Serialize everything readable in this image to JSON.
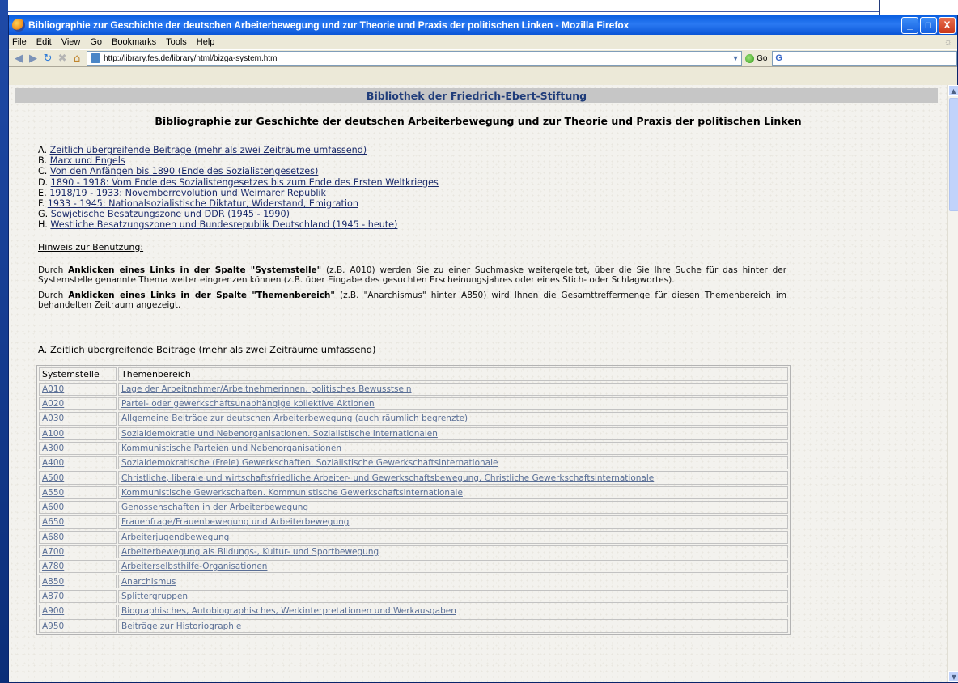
{
  "window": {
    "title": "Bibliographie zur Geschichte der deutschen Arbeiterbewegung und zur Theorie und Praxis der politischen Linken - Mozilla Firefox",
    "minimize": "_",
    "maximize": "□",
    "close": "X"
  },
  "menu": [
    "File",
    "Edit",
    "View",
    "Go",
    "Bookmarks",
    "Tools",
    "Help"
  ],
  "navigation": {
    "url": "http://library.fes.de/library/html/bizga-system.html",
    "go_label": "Go",
    "search_icon": "G"
  },
  "page": {
    "library_header": "Bibliothek der Friedrich-Ebert-Stiftung",
    "title": "Bibliographie zur Geschichte der deutschen Arbeiterbewegung und zur Theorie und Praxis der politischen Linken",
    "toc": [
      {
        "letter": "A.",
        "text": "Zeitlich übergreifende Beiträge (mehr als zwei Zeiträume umfassend)"
      },
      {
        "letter": "B.",
        "text": "Marx und Engels"
      },
      {
        "letter": "C.",
        "text": "Von den Anfängen bis 1890 (Ende des Sozialistengesetzes)"
      },
      {
        "letter": "D.",
        "text": "1890 - 1918: Vom Ende des Sozialistengesetzes bis zum Ende des Ersten Weltkrieges"
      },
      {
        "letter": "E.",
        "text": "1918/19 - 1933: Novemberrevolution und Weimarer Republik"
      },
      {
        "letter": "F.",
        "text": "1933 - 1945: Nationalsozialistische Diktatur, Widerstand, Emigration"
      },
      {
        "letter": "G.",
        "text": "Sowjetische Besatzungszone und DDR (1945 - 1990)"
      },
      {
        "letter": "H.",
        "text": "Westliche Besatzungszonen und Bundesrepublik Deutschland (1945 - heute)"
      }
    ],
    "hint_heading": "Hinweis zur Benutzung:",
    "hint1": {
      "pre": "Durch ",
      "bold": "Anklicken eines Links in der Spalte \"Systemstelle\"",
      "post": " (z.B. A010) werden Sie zu einer Suchmaske weitergeleitet, über die Sie Ihre Suche für das hinter der Systemstelle genannte Thema weiter eingrenzen können (z.B. über Eingabe des gesuchten Erscheinungsjahres oder eines Stich- oder Schlagwortes)."
    },
    "hint2": {
      "pre": "Durch ",
      "bold": "Anklicken eines Links in der Spalte \"Themenbereich\"",
      "post": " (z.B. \"Anarchismus\" hinter A850) wird Ihnen die Gesamttreffermenge für diesen Themenbereich im behandelten Zeitraum angezeigt."
    },
    "section_heading": "A. Zeitlich übergreifende Beiträge (mehr als zwei Zeiträume umfassend)",
    "table": {
      "headers": [
        "Systemstelle",
        "Themenbereich"
      ],
      "rows": [
        [
          "A010",
          "Lage der Arbeitnehmer/Arbeitnehmerinnen, politisches Bewusstsein"
        ],
        [
          "A020",
          "Partei- oder gewerkschaftsunabhängige kollektive Aktionen"
        ],
        [
          "A030",
          "Allgemeine Beiträge zur deutschen Arbeiterbewegung (auch räumlich begrenzte)"
        ],
        [
          "A100",
          "Sozialdemokratie und Nebenorganisationen. Sozialistische Internationalen"
        ],
        [
          "A300",
          "Kommunistische Parteien und Nebenorganisationen"
        ],
        [
          "A400",
          "Sozialdemokratische (Freie) Gewerkschaften. Sozialistische Gewerkschaftsinternationale"
        ],
        [
          "A500",
          "Christliche, liberale und wirtschaftsfriedliche Arbeiter- und Gewerkschaftsbewegung. Christliche Gewerkschaftsinternationale"
        ],
        [
          "A550",
          "Kommunistische Gewerkschaften. Kommunistische Gewerkschaftsinternationale"
        ],
        [
          "A600",
          "Genossenschaften in der Arbeiterbewegung"
        ],
        [
          "A650",
          "Frauenfrage/Frauenbewegung und Arbeiterbewegung"
        ],
        [
          "A680",
          "Arbeiterjugendbewegung"
        ],
        [
          "A700",
          "Arbeiterbewegung als Bildungs-, Kultur- und Sportbewegung"
        ],
        [
          "A780",
          "Arbeiterselbsthilfe-Organisationen"
        ],
        [
          "A850",
          "Anarchismus"
        ],
        [
          "A870",
          "Splittergruppen"
        ],
        [
          "A900",
          "Biographisches, Autobiographisches, Werkinterpretationen und Werkausgaben"
        ],
        [
          "A950",
          "Beiträge zur Historiographie"
        ]
      ]
    }
  }
}
